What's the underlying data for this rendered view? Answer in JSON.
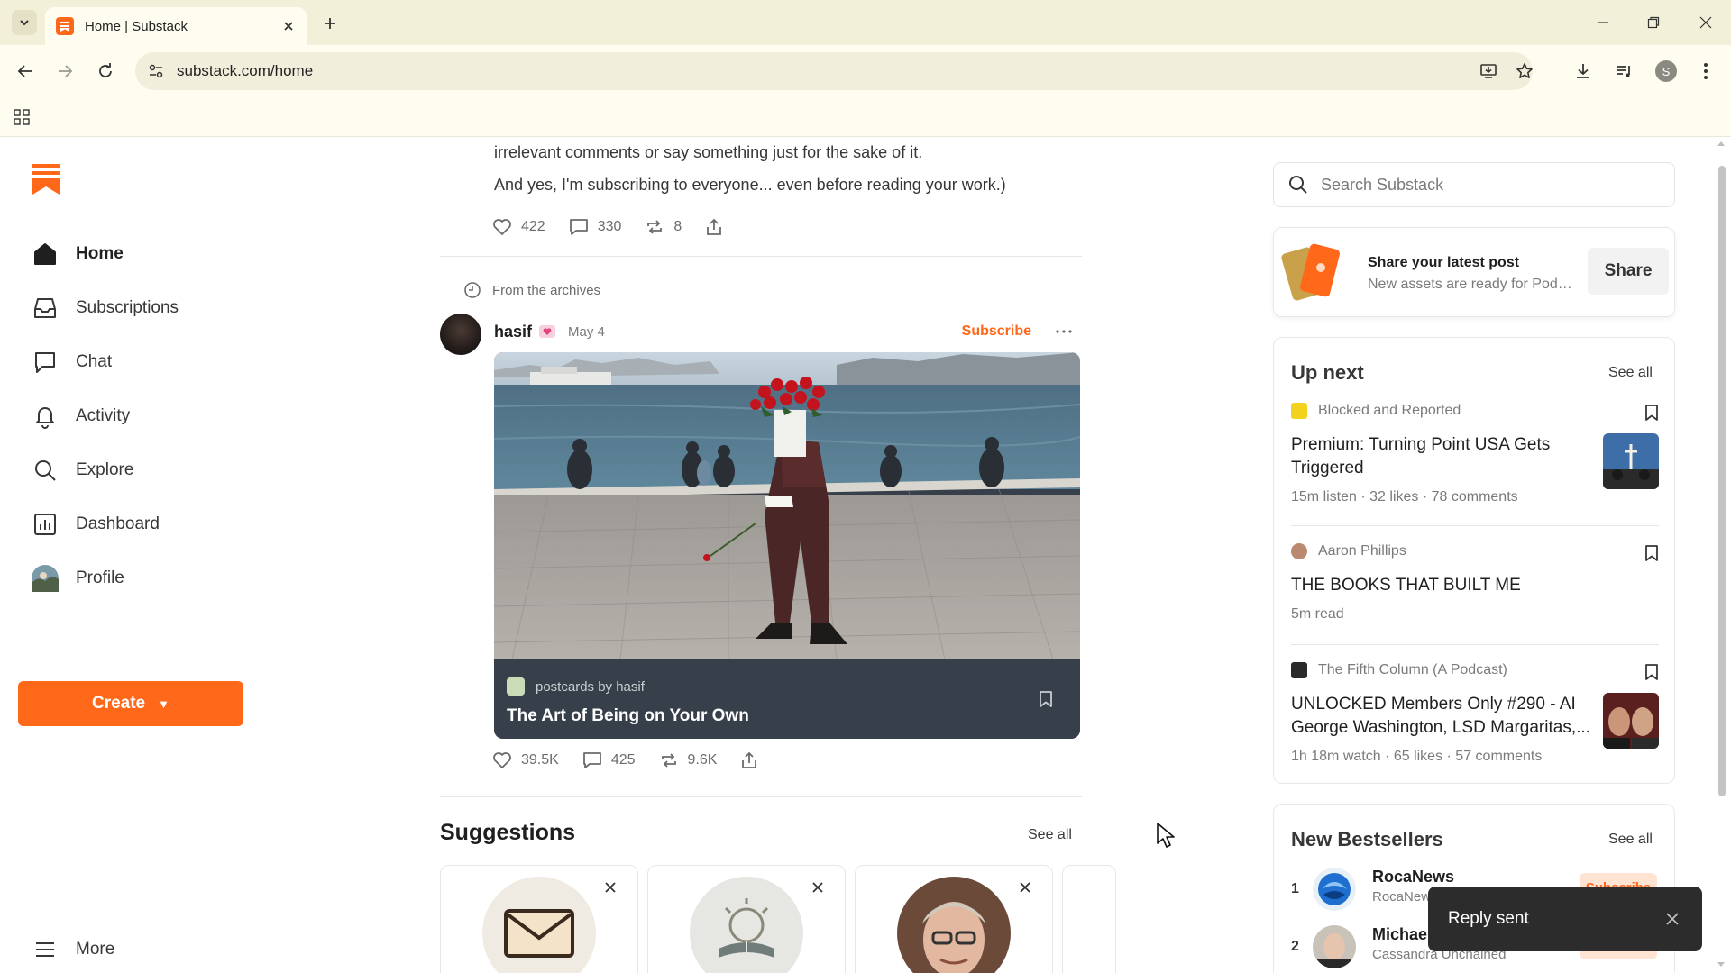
{
  "browser": {
    "tab_title": "Home | Substack",
    "url": "substack.com/home",
    "profile_initial": "S"
  },
  "nav": {
    "items": [
      {
        "label": "Home",
        "icon": "home-icon"
      },
      {
        "label": "Subscriptions",
        "icon": "inbox-icon"
      },
      {
        "label": "Chat",
        "icon": "chat-icon"
      },
      {
        "label": "Activity",
        "icon": "bell-icon"
      },
      {
        "label": "Explore",
        "icon": "search-icon"
      },
      {
        "label": "Dashboard",
        "icon": "bar-chart-icon"
      },
      {
        "label": "Profile",
        "icon": "profile-avatar"
      }
    ],
    "create_label": "Create",
    "more_label": "More"
  },
  "feed": {
    "post1": {
      "line1": "irrelevant comments or say something just for the sake of it.",
      "line2": "And yes, I'm subscribing to everyone... even before reading your work.)",
      "likes": "422",
      "comments": "330",
      "restacks": "8"
    },
    "archive_label": "From the archives",
    "post2": {
      "author": "hasif",
      "date": "May 4",
      "subscribe_label": "Subscribe",
      "publication": "postcards by hasif",
      "title": "The Art of Being on Your Own",
      "likes": "39.5K",
      "comments": "425",
      "restacks": "9.6K"
    },
    "suggestions_title": "Suggestions",
    "see_all": "See all"
  },
  "sidebar": {
    "search_placeholder": "Search Substack",
    "share": {
      "heading": "Share your latest post",
      "sub": "New assets are ready for Podc...",
      "button": "Share"
    },
    "up_next": {
      "title": "Up next",
      "see_all": "See all",
      "items": [
        {
          "source": "Blocked and Reported",
          "title": "Premium: Turning Point USA Gets Triggered",
          "meta": "15m listen · 32 likes · 78 comments"
        },
        {
          "source": "Aaron Phillips",
          "title": "THE BOOKS THAT BUILT ME",
          "meta": "5m read"
        },
        {
          "source": "The Fifth Column (A Podcast)",
          "title": "UNLOCKED Members Only #290 - AI George Washington, LSD Margaritas,...",
          "meta": "1h 18m watch · 65 likes · 57 comments"
        }
      ]
    },
    "bestsellers": {
      "title": "New Bestsellers",
      "see_all": "See all",
      "items": [
        {
          "rank": "1",
          "name": "RocaNews",
          "sub": "RocaNew",
          "button": "Subscribe"
        },
        {
          "rank": "2",
          "name": "Michael",
          "sub": "Cassandra Unchained",
          "button": "Subscribe"
        }
      ]
    }
  },
  "toast": {
    "text": "Reply sent"
  },
  "colors": {
    "accent": "#ff6719",
    "chrome": "#f2f0d8",
    "toast_bg": "#2c2c2c"
  }
}
